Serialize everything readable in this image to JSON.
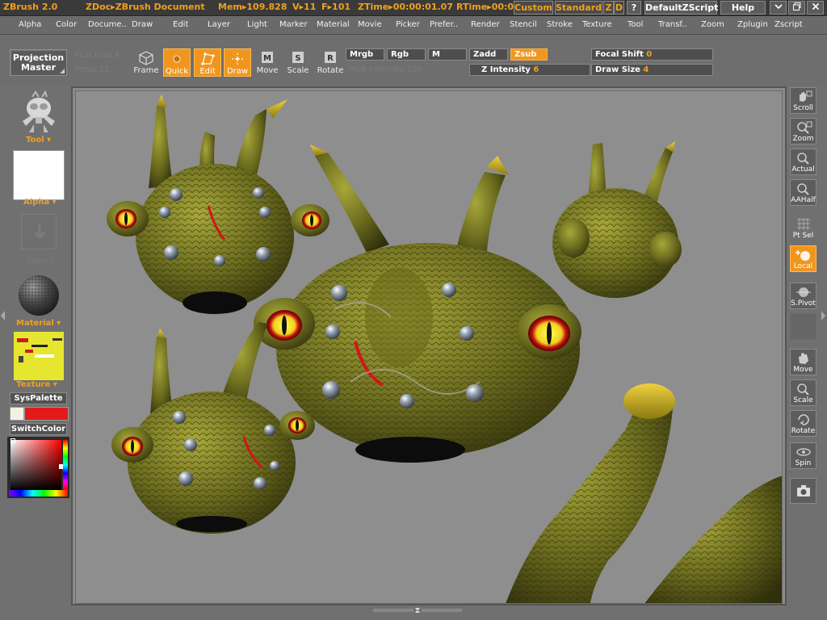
{
  "titlebar": {
    "app": "ZBrush 2.0",
    "doc": "ZDoc▸ZBrush Document",
    "mem": "Mem▸109.828",
    "v": "V▸11",
    "f": "F▸101",
    "ztime": "ZTime▸00:00:01.07",
    "rtime": "RTime▸00:0",
    "custom": "Custom",
    "standard": "Standard",
    "z": "Z",
    "d": "D",
    "question": "?",
    "zscript": "DefaultZScript",
    "help": "Help"
  },
  "menu": [
    "Alpha",
    "Color",
    "Docume..",
    "Draw",
    "Edit",
    "Layer",
    "Light",
    "Marker",
    "Material",
    "Movie",
    "Picker",
    "Prefer..",
    "Render",
    "Stencil",
    "Stroke",
    "Texture",
    "Tool",
    "Transf..",
    "Zoom",
    "Zplugin",
    "Zscript"
  ],
  "shelf": {
    "projection_master": [
      "Projection",
      "Master"
    ],
    "ghost1": "RGB  RGB A",
    "ghost2": "Presp  25",
    "ghost3": "RGB Intensity  100",
    "frame": "Frame",
    "quick": "Quick",
    "edit": "Edit",
    "draw": "Draw",
    "move": "Move",
    "scale": "Scale",
    "rotate": "Rotate",
    "mrgb": "Mrgb",
    "rgb": "Rgb",
    "m": "M",
    "zadd": "Zadd",
    "zsub": "Zsub",
    "focal_label": "Focal Shift",
    "focal_value": "0",
    "zint_label": "Z Intensity",
    "zint_value": "6",
    "drawsize_label": "Draw Size",
    "drawsize_value": "4"
  },
  "left": {
    "tool": "Tool",
    "alpha": "Alpha",
    "stencil": "Stencil",
    "material": "Material",
    "texture": "Texture",
    "syspalette": "SysPalette",
    "switchcolor": "SwitchColor",
    "primary_color": "#f6f0e2",
    "secondary_color": "#e21a1a"
  },
  "right": {
    "scroll": "Scroll",
    "zoom": "Zoom",
    "actual": "Actual",
    "aahalf": "AAHalf",
    "ptsel": "Pt Sel",
    "local": "Local",
    "spivot": "S.Pivot",
    "move": "Move",
    "scale": "Scale",
    "rotate": "Rotate",
    "spin": "Spin"
  },
  "colors": {
    "accent": "#f0961e",
    "label_orange": "#f0a020",
    "canvas_bg": "#8e8e8e"
  }
}
